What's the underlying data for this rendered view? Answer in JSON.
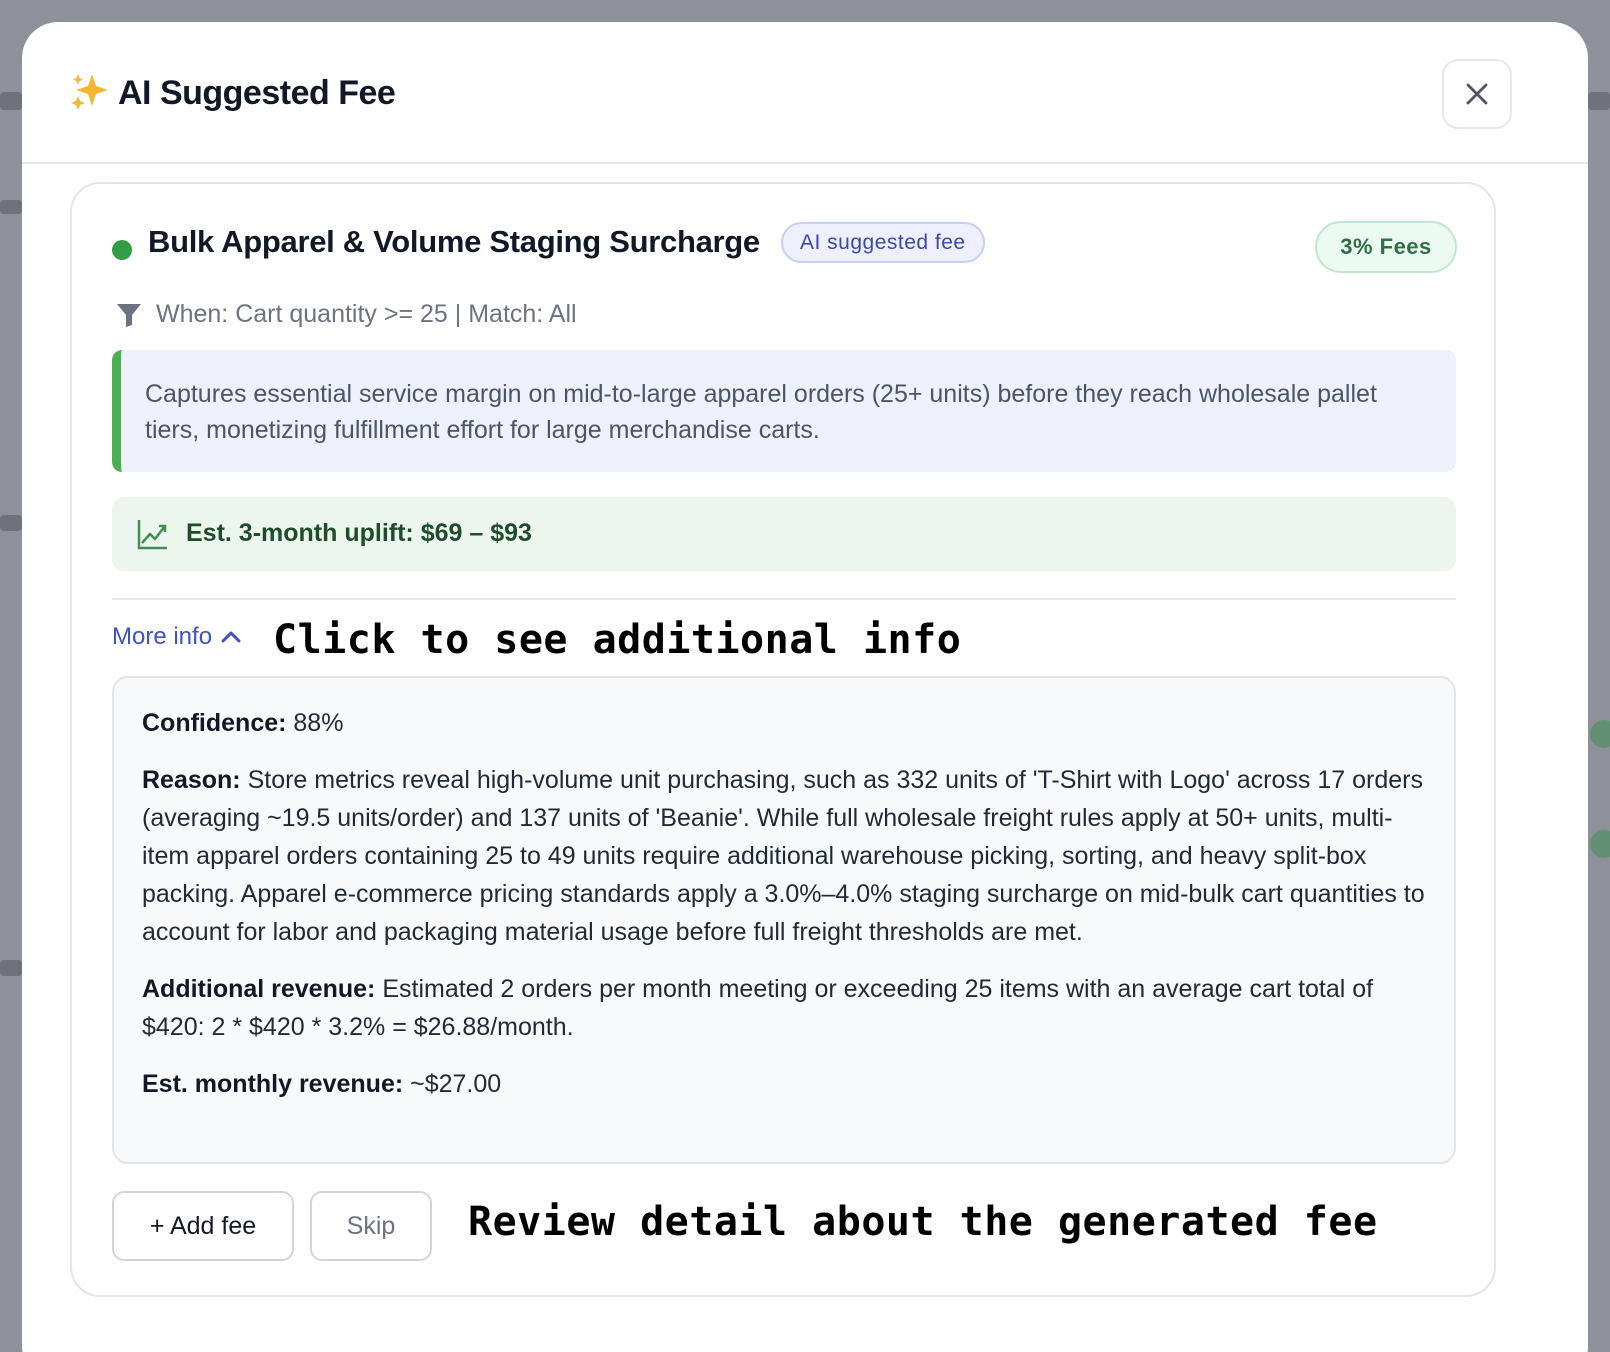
{
  "modal": {
    "title": "AI Suggested Fee",
    "title_icon": "sparkle-icon",
    "close_icon": "close-icon"
  },
  "fee": {
    "name": "Bulk Apparel & Volume Staging Surcharge",
    "status_color": "#2f9e44",
    "ai_badge": "AI suggested fee",
    "fee_badge": "3% Fees",
    "condition_icon": "filter-icon",
    "condition": "When: Cart quantity >= 25 | Match: All",
    "description": "Captures essential service margin on mid-to-large apparel orders (25+ units) before they reach wholesale pallet tiers, monetizing fulfillment effort for large merchandise carts.",
    "uplift_icon": "trending-up-icon",
    "uplift": "Est. 3-month uplift: $69 – $93"
  },
  "more_info": {
    "label": "More info",
    "icon": "chevron-up-icon",
    "confidence_label": "Confidence:",
    "confidence_value": " 88%",
    "reason_label": "Reason:",
    "reason_value": " Store metrics reveal high-volume unit purchasing, such as 332 units of 'T-Shirt with Logo' across 17 orders (averaging ~19.5 units/order) and 137 units of 'Beanie'. While full wholesale freight rules apply at 50+ units, multi-item apparel orders containing 25 to 49 units require additional warehouse picking, sorting, and heavy split-box packing. Apparel e-commerce pricing standards apply a 3.0%–4.0% staging surcharge on mid-bulk cart quantities to account for labor and packaging material usage before full freight thresholds are met.",
    "additional_label": "Additional revenue:",
    "additional_value": " Estimated 2 orders per month meeting or exceeding 25 items with an average cart total of $420: 2 * $420 * 3.2% = $26.88/month.",
    "monthly_label": "Est. monthly revenue:",
    "monthly_value": " ~$27.00"
  },
  "actions": {
    "add_fee": "+ Add fee",
    "skip": "Skip"
  },
  "annotations": {
    "top": "Click to see additional info",
    "bottom": "Review detail about the generated fee"
  },
  "colors": {
    "accent_blue": "#3f51c8",
    "success_green": "#2f9e44",
    "description_bg": "#eef0fb",
    "uplift_bg": "#edf6ee"
  }
}
